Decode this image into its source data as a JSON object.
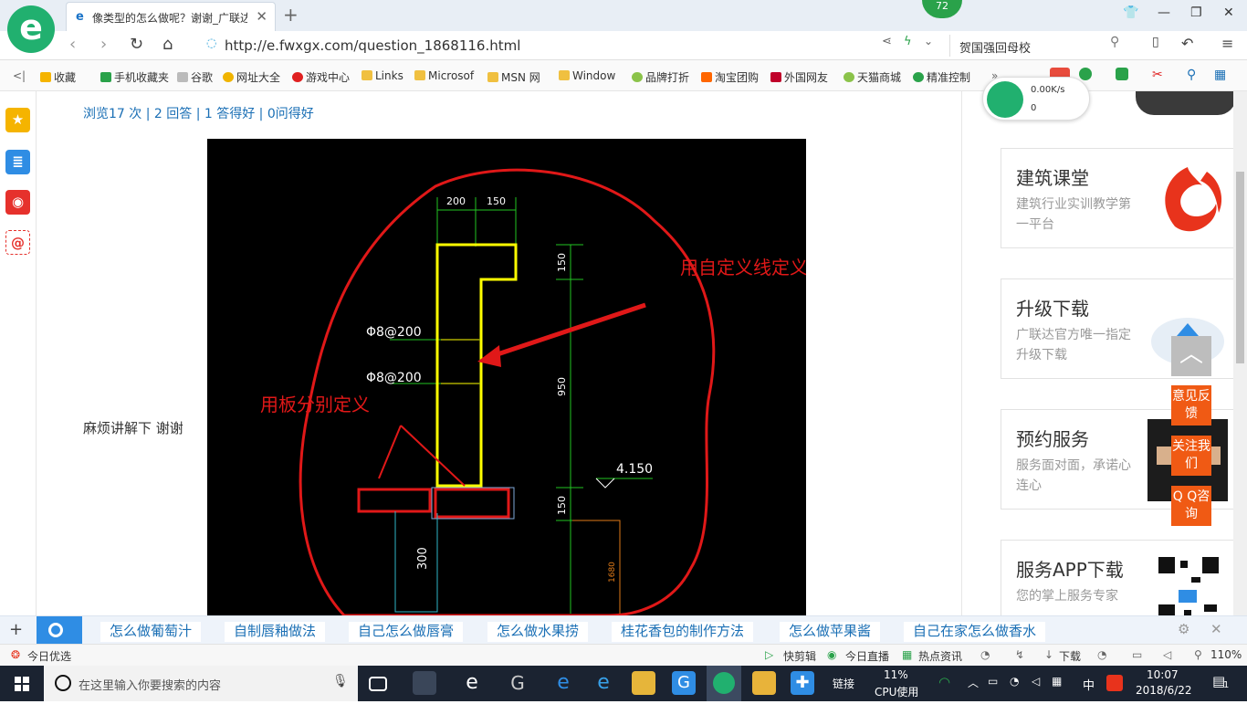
{
  "browser": {
    "tab_title": "像类型的怎么做呢？谢谢_广联达",
    "url": "http://e.fwxgx.com/question_1868116.html",
    "search_text": "贺国强回母校",
    "badge_count": "72"
  },
  "bookmarks": [
    {
      "label": "收藏",
      "color": "#f5b400"
    },
    {
      "label": "手机收藏夹",
      "color": "#2aa24a"
    },
    {
      "label": "谷歌",
      "color": "#bbbbbb"
    },
    {
      "label": "网址大全",
      "color": "#f0b400"
    },
    {
      "label": "游戏中心",
      "color": "#e02020"
    },
    {
      "label": "Links",
      "color": "#f0c040"
    },
    {
      "label": "Microsof",
      "color": "#f0c040"
    },
    {
      "label": "MSN 网",
      "color": "#f0c040"
    },
    {
      "label": "Window",
      "color": "#f0c040"
    },
    {
      "label": "品牌打折",
      "color": "#8bc34a"
    },
    {
      "label": "淘宝团购",
      "color": "#ff6600"
    },
    {
      "label": "外国网友",
      "color": "#c0002a"
    },
    {
      "label": "天猫商城",
      "color": "#8bc34a"
    },
    {
      "label": "精准控制",
      "color": "#2aa24a"
    }
  ],
  "page": {
    "stats": "浏览17 次 | 2 回答 | 1 答得好 | 0问得好",
    "body_text": "麻烦讲解下  谢谢"
  },
  "drawing": {
    "dim_top_1": "200",
    "dim_top_2": "150",
    "dim_right_1": "150",
    "dim_right_2": "950",
    "dim_right_3": "150",
    "rebar_1": "Φ8@200",
    "rebar_2": "Φ8@200",
    "elevation": "4.150",
    "dim_bottom": "300",
    "dim_orange": "1680",
    "label_1": "用自定义线定义",
    "label_2": "用板分别定义"
  },
  "network": {
    "speed": "0.00K/s",
    "count": "0"
  },
  "right_cards": [
    {
      "title": "建筑课堂",
      "desc": "建筑行业实训教学第一平台"
    },
    {
      "title": "升级下载",
      "desc": "广联达官方唯一指定升级下载"
    },
    {
      "title": "预约服务",
      "desc": "服务面对面，承诺心连心"
    },
    {
      "title": "服务APP下载",
      "desc": "您的掌上服务专家"
    }
  ],
  "float_buttons": {
    "feedback": "意见反馈",
    "follow": "关注我们",
    "qq": "Q Q咨询"
  },
  "hot_searches": [
    "怎么做葡萄汁",
    "自制唇釉做法",
    "自己怎么做唇膏",
    "怎么做水果捞",
    "桂花香包的制作方法",
    "怎么做苹果酱",
    "自己在家怎么做香水"
  ],
  "status": {
    "left": "今日优选",
    "items": [
      "快剪辑",
      "今日直播",
      "热点资讯",
      "下载"
    ],
    "zoom": "110%"
  },
  "taskbar": {
    "search_placeholder": "在这里输入你要搜索的内容",
    "link_label": "链接",
    "cpu_percent": "11%",
    "cpu_label": "CPU使用",
    "ime": "中",
    "time": "10:07",
    "date": "2018/6/22",
    "notification_count": "1"
  }
}
